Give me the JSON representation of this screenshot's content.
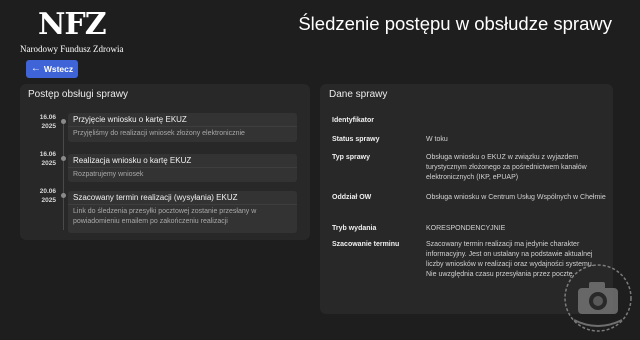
{
  "header": {
    "logo_text": "NFZ",
    "logo_caption": "Narodowy Fundusz Zdrowia",
    "title": "Śledzenie postępu w obsłudze sprawy"
  },
  "back_button": {
    "label": "Wstecz",
    "icon": "arrow-left-icon"
  },
  "progress_panel": {
    "title": "Postęp obsługi sprawy",
    "steps": [
      {
        "date_day": "16.06",
        "date_year": "2025",
        "title": "Przyjęcie wniosku o kartę EKUZ",
        "description": "Przyjęliśmy do realizacji wniosek złożony elektronicznie"
      },
      {
        "date_day": "16.06",
        "date_year": "2025",
        "title": "Realizacja wniosku o kartę EKUZ",
        "description": "Rozpatrujemy wniosek"
      },
      {
        "date_day": "20.06",
        "date_year": "2025",
        "title": "Szacowany termin realizacji (wysyłania) EKUZ",
        "description": "Link do śledzenia przesyłki pocztowej zostanie przesłany w powiadomieniu emailem po zakończeniu realizacji"
      }
    ]
  },
  "details_panel": {
    "title": "Dane sprawy",
    "rows": [
      {
        "label": "Identyfikator",
        "value": ""
      },
      {
        "label": "Status sprawy",
        "value": "W toku"
      },
      {
        "label": "Typ sprawy",
        "value": "Obsługa wniosku o EKUZ w związku z wyjazdem turystycznym złożonego za pośrednictwem kanałów elektronicznych (IKP, ePUAP)"
      },
      {
        "label": "Oddział OW",
        "value": "Obsługa wniosku w Centrum Usług Wspólnych w Chełmie"
      },
      {
        "label": "Tryb wydania",
        "value": "KORESPONDENCYJNIE"
      },
      {
        "label": "Szacowanie terminu",
        "value": "Szacowany termin realizacji ma jedynie charakter informacyjny. Jest on ustalany na podstawie aktualnej liczby wniosków w realizacji oraz wydajności systemu. Nie uwzględnia czasu przesyłania przez pocztę."
      }
    ]
  },
  "watermark": {
    "icon": "camera-watermark-icon"
  }
}
